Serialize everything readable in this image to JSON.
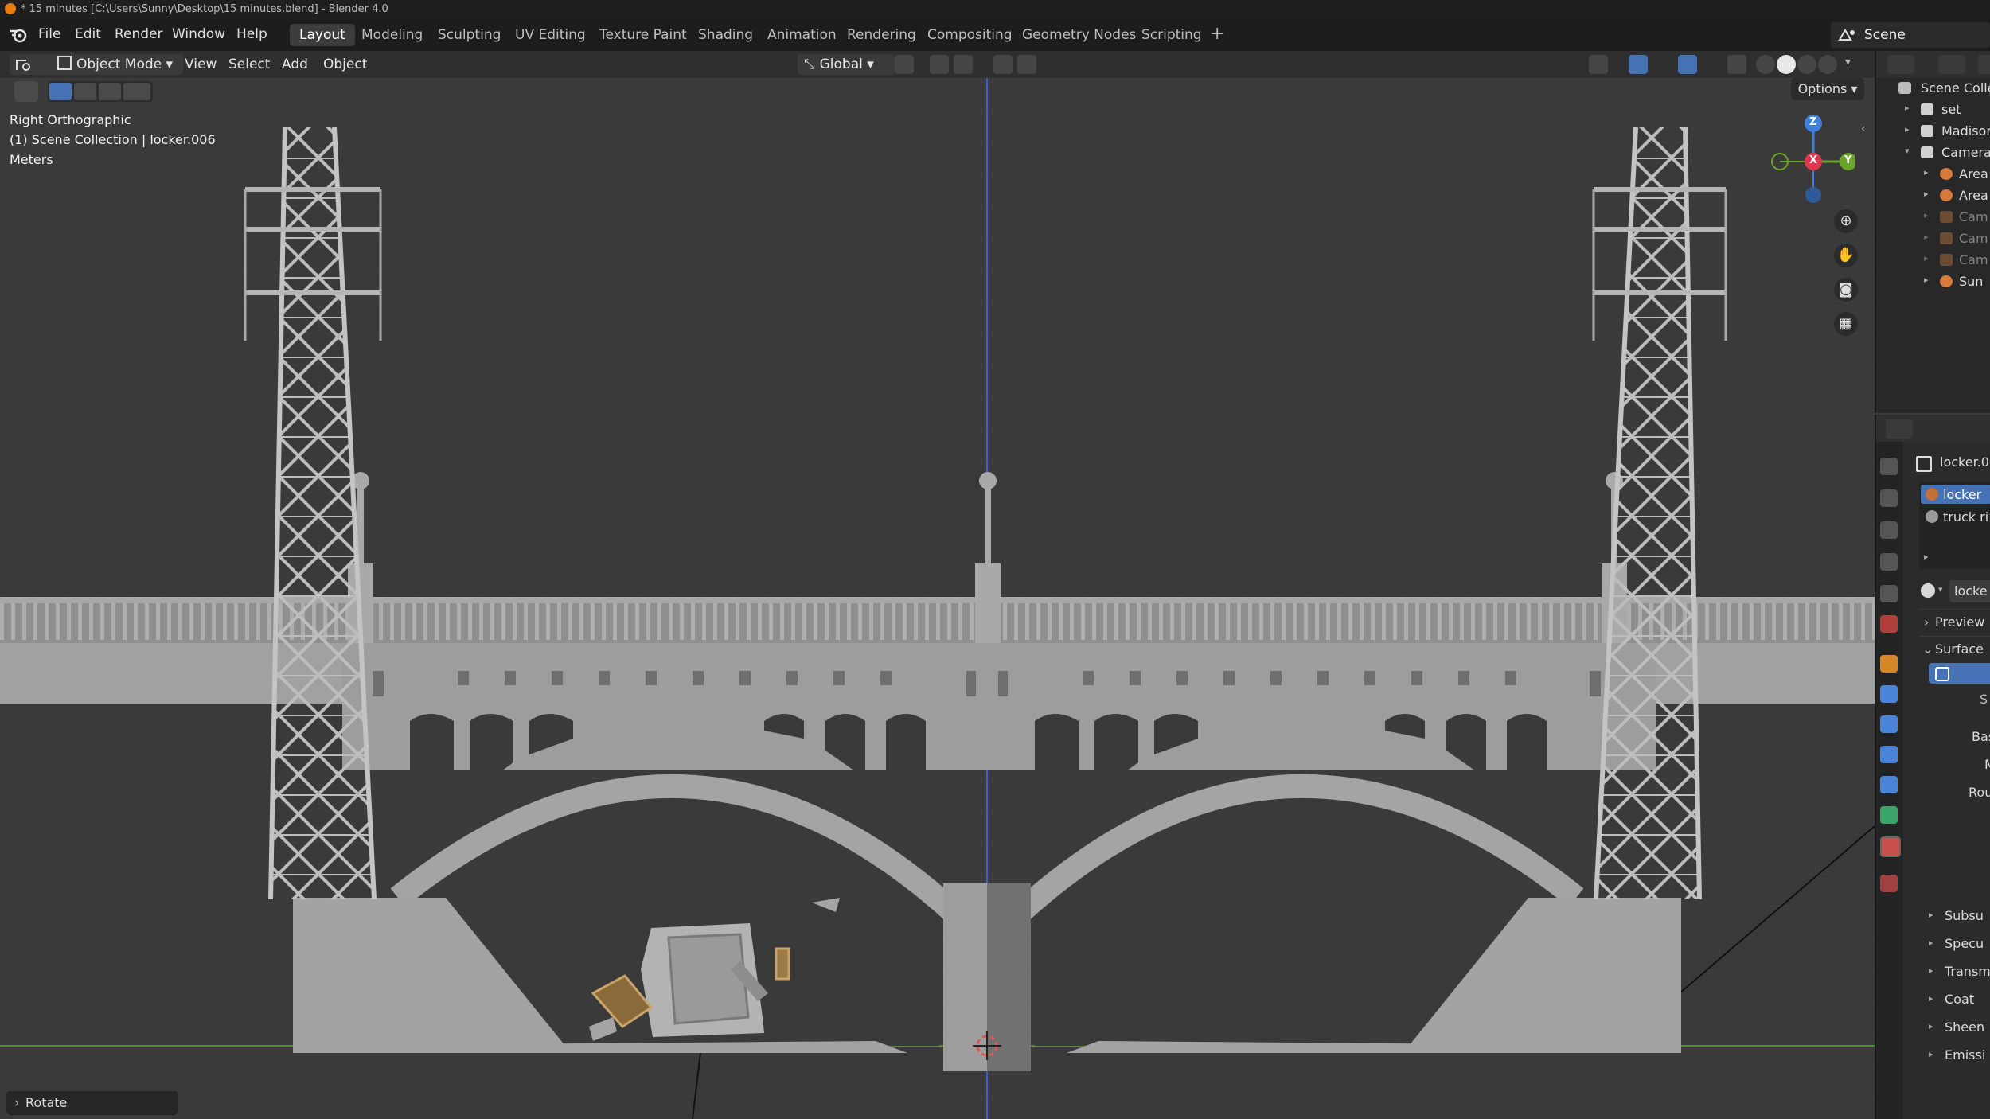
{
  "window": {
    "title": "* 15 minutes [C:\\Users\\Sunny\\Desktop\\15 minutes.blend] - Blender 4.0"
  },
  "menus": [
    "File",
    "Edit",
    "Render",
    "Window",
    "Help"
  ],
  "workspaces": [
    "Layout",
    "Modeling",
    "Sculpting",
    "UV Editing",
    "Texture Paint",
    "Shading",
    "Animation",
    "Rendering",
    "Compositing",
    "Geometry Nodes",
    "Scripting"
  ],
  "active_workspace": "Layout",
  "scene": {
    "name": "Scene"
  },
  "viewport_header": {
    "mode": "Object Mode",
    "menus": [
      "View",
      "Select",
      "Add",
      "Object"
    ],
    "orientation": "Global",
    "options_label": "Options"
  },
  "viewport_overlay": {
    "view_name": "Right Orthographic",
    "collection_info": "(1) Scene Collection | locker.006",
    "units": "Meters"
  },
  "gizmo": {
    "z": "Z",
    "x": "X",
    "y": "Y"
  },
  "last_operator": "Rotate",
  "outliner": {
    "root": "Scene Colle",
    "items": [
      {
        "label": "set",
        "arrow": "▸",
        "icon": "collection"
      },
      {
        "label": "Madison",
        "arrow": "▸",
        "icon": "collection"
      },
      {
        "label": "Camera",
        "arrow": "▾",
        "icon": "collection"
      },
      {
        "label": "Area",
        "arrow": "▸",
        "icon": "light"
      },
      {
        "label": "Area",
        "arrow": "▸",
        "icon": "light"
      },
      {
        "label": "Cam",
        "arrow": "▸",
        "icon": "camera"
      },
      {
        "label": "Cam",
        "arrow": "▸",
        "icon": "camera"
      },
      {
        "label": "Cam",
        "arrow": "▸",
        "icon": "camera"
      },
      {
        "label": "Sun",
        "arrow": "▸",
        "icon": "light"
      }
    ]
  },
  "properties": {
    "object_name": "locker.0",
    "material_slots": [
      "locker",
      "truck ri"
    ],
    "material_name": "locke",
    "panels": [
      "Preview",
      "Surface"
    ],
    "fields": [
      "Bas",
      "M",
      "Rou"
    ],
    "subpanels": [
      "Subsu",
      "Specu",
      "Transm",
      "Coat",
      "Sheen",
      "Emissi"
    ]
  },
  "colors": {
    "accent": "#4772b3",
    "axis_x": "#e0394f",
    "axis_y": "#6ba42a",
    "axis_z": "#3d7fd9",
    "bridge": "#9a9a9a"
  }
}
